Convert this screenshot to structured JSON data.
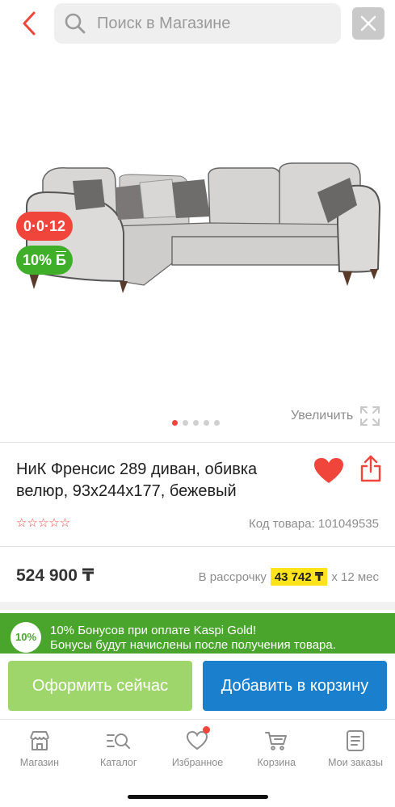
{
  "search": {
    "placeholder": "Поиск в Магазине"
  },
  "gallery": {
    "badge_installment": "0·0·12",
    "badge_bonus": "10%",
    "badge_bonus_b": "Б",
    "zoom_label": "Увеличить",
    "slide_count": 5,
    "active_slide": 1
  },
  "product": {
    "title": "НиК Френсис 289 диван, обивка велюр, 93x244x177, бежевый",
    "rating_stars": "☆☆☆☆☆",
    "sku": "Код товара: 101049535"
  },
  "price": {
    "value": "524 900 ₸",
    "installment_prefix": "В рассрочку",
    "installment_amount": "43 742 ₸",
    "installment_suffix": "х 12 мес"
  },
  "bonus": {
    "badge": "10%",
    "line1": "10% Бонусов при оплате Kaspi Gold!",
    "line2": "Бонусы будут начислены после получения товара."
  },
  "actions": {
    "checkout": "Оформить сейчас",
    "add_to_cart": "Добавить в корзину"
  },
  "nav": {
    "shop": "Магазин",
    "catalog": "Каталог",
    "favorites": "Избранное",
    "cart": "Корзина",
    "orders": "Мои заказы"
  },
  "colors": {
    "accent_red": "#f0453a",
    "bonus_green": "#4aa52d",
    "cart_blue": "#1a7fcc",
    "checkout_green": "#9fd66b",
    "highlight_yellow": "#ffe41c"
  }
}
